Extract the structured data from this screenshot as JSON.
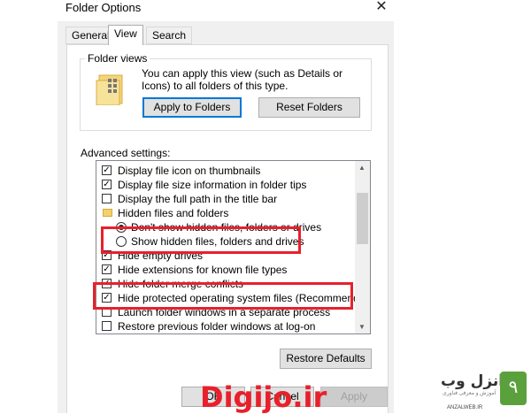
{
  "window": {
    "title": "Folder Options",
    "close_glyph": "✕"
  },
  "tabs": [
    {
      "label": "General",
      "active": false
    },
    {
      "label": "View",
      "active": true
    },
    {
      "label": "Search",
      "active": false
    }
  ],
  "folder_views": {
    "label": "Folder views",
    "description": "You can apply this view (such as Details or Icons) to all folders of this type.",
    "apply_button": "Apply to Folders",
    "reset_button": "Reset Folders"
  },
  "advanced": {
    "label": "Advanced settings:",
    "items": [
      {
        "type": "checkbox",
        "checked": true,
        "label": "Display file icon on thumbnails"
      },
      {
        "type": "checkbox",
        "checked": true,
        "label": "Display file size information in folder tips"
      },
      {
        "type": "checkbox",
        "checked": false,
        "label": "Display the full path in the title bar"
      },
      {
        "type": "folder",
        "label": "Hidden files and folders"
      },
      {
        "type": "radio",
        "checked": true,
        "label": "Don't show hidden files, folders or drives"
      },
      {
        "type": "radio",
        "checked": false,
        "label": "Show hidden files, folders and drives"
      },
      {
        "type": "checkbox",
        "checked": true,
        "label": "Hide empty drives"
      },
      {
        "type": "checkbox",
        "checked": true,
        "label": "Hide extensions for known file types"
      },
      {
        "type": "checkbox",
        "checked": true,
        "label": "Hide folder merge conflicts"
      },
      {
        "type": "checkbox",
        "checked": true,
        "label": "Hide protected operating system files (Recommended)"
      },
      {
        "type": "checkbox",
        "checked": false,
        "label": "Launch folder windows in a separate process"
      },
      {
        "type": "checkbox",
        "checked": false,
        "label": "Restore previous folder windows at log-on"
      }
    ]
  },
  "restore_defaults": "Restore Defaults",
  "footer": {
    "ok": "OK",
    "cancel": "Cancel",
    "apply": "Apply"
  },
  "watermark": {
    "logo": "Digijo.ir",
    "brand": "انزل وب",
    "sub": "آموزش و معرفی فناوری",
    "url": "ANZALWEB.IR",
    "badge": "٩"
  },
  "colors": {
    "highlight_box": "#e8202b",
    "accent": "#0078d7"
  }
}
